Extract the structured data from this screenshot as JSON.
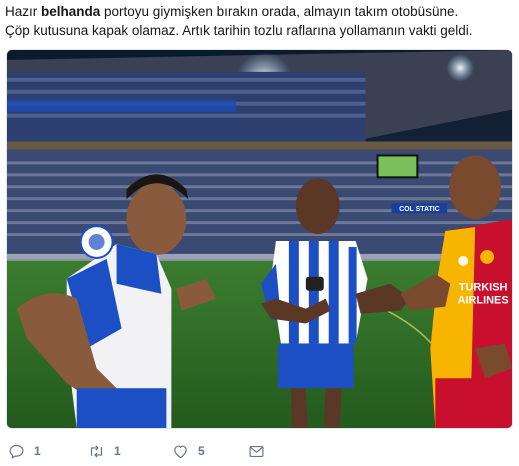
{
  "tweet": {
    "line1_pre": "Hazır ",
    "line1_bold": "belhanda",
    "line1_post": " portoyu giymişken bırakın orada, almayın takım otobüsüne.",
    "line2": "Çöp kutusuna kapak olamaz. Artık tarihin tozlu raflarına yollamanın vakti geldi."
  },
  "media": {
    "sponsor_line1": "TURKISH",
    "sponsor_line2": "AIRLINES",
    "board_text": "COL STATIC"
  },
  "actions": {
    "reply_count": "1",
    "retweet_count": "1",
    "like_count": "5"
  },
  "colors": {
    "text": "#14171a",
    "muted": "#657786",
    "porto_blue": "#1c4fc4",
    "gala_red": "#c8102e",
    "gala_yellow": "#f7b500",
    "pitch": "#2d6b27"
  }
}
